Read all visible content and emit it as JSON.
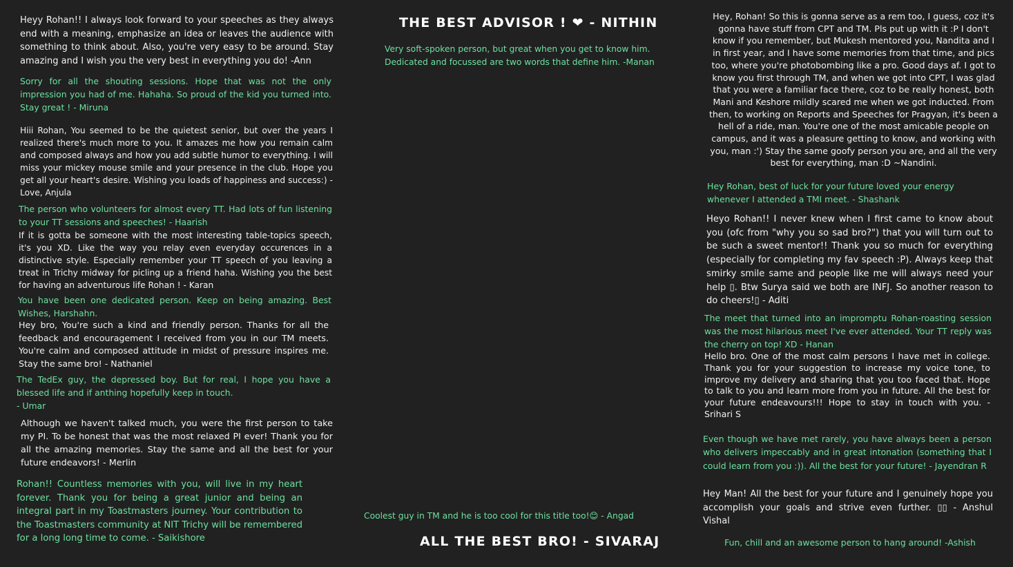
{
  "left": [
    "Heyy Rohan!! I always look forward to your speeches as they always end with a meaning, emphasize an idea or leaves the audience with something to think about. Also, you're very easy to be around. Stay amazing and I wish you the very best in everything you do!  -Ann",
    "Sorry for all the shouting sessions. Hope that was not the only impression you had of me. Hahaha. So proud of the kid you turned into. Stay great !  - Miruna",
    "Hiii Rohan, You seemed to be the quietest senior, but over the years I realized there's much more to you. It amazes me how you remain calm and composed always and how you add subtle humor to everything. I will miss your mickey mouse smile and your presence in the club. Hope you get all your heart's desire. Wishing you loads of happiness and success:) -Love, Anjula",
    "The person who volunteers for almost every TT. Had lots of fun listening to your TT sessions and speeches!  - Haarish",
    "If it is gotta be someone with the most interesting table-topics speech, it's you XD. Like the way you relay even everyday occurences in a distinctive style. Especially remember your TT speech of you leaving a treat in Trichy midway for picling up a friend haha. Wishing you the best for having an adventurous life Rohan ! - Karan",
    "You have been one dedicated person. Keep on being amazing. Best Wishes, Harshahn.",
    "Hey bro, You're such a kind and friendly person. Thanks for all the feedback and encouragement I received from you in our TM meets. You're calm and composed attitude in midst of pressure inspires me. Stay the same bro!  - Nathaniel",
    "The TedEx guy, the depressed boy. But for real, I hope you have a blessed life and if anthing hopefully keep in touch.",
    "- Umar",
    "Although we haven't talked much, you were the first person to take my PI. To be honest that was the most relaxed PI ever! Thank you for all the amazing memories. Stay the same and all the best for your future endeavors! - Merlin",
    "Rohan!! Countless memories with you, will live in my heart forever. Thank you for being a great junior and being an integral part in my Toastmasters journey. Your contribution to the Toastmasters community at NIT Trichy will be remembered for a long long time to come.  - Saikishore"
  ],
  "middle": {
    "heading_top": "THE BEST ADVISOR ! ❤ - NITHIN",
    "note_top": "Very soft-spoken person, but great when you get to know him. Dedicated and focussed are two words that define him. -Manan",
    "note_bottom": "Coolest guy in TM and he is too cool for this title too!😊 - Angad",
    "heading_bottom": "ALL THE BEST BRO! - SIVARAJ"
  },
  "right": [
    "Hey, Rohan! So this is gonna serve as a rem too, I guess, coz it's gonna have stuff from CPT and TM. Pls put up with it :P I don't know if you remember, but Mukesh mentored you, Nandita and I in first year, and I have some memories from that time, and pics too, where you're photobombing like a pro. Good days af. I got to know you first through TM, and when we got into CPT, I was glad that you were a familiar face there, coz to be really honest, both Mani and Keshore mildly scared me when we got inducted. From then, to working on Reports and Speeches for Pragyan, it's been a hell of a ride, man. You're one of the most amicable people on campus, and it was a pleasure getting to know, and working with you, man :') Stay the same goofy person you are, and all the very best for everything, man :D ~Nandini.",
    "Hey Rohan, best of luck for your future loved your energy whenever I attended a TMI meet.  - Shashank",
    "Heyo Rohan!! I never knew when I first came to know about you (ofc from \"why you so sad bro?\") that you will turn out to be such a sweet mentor!! Thank you so much for everything (especially for completing my fav speech :P). Always keep that smirky smile same and people like me will always need your help ▯. Btw Surya said we both are INFJ. So another reason to do cheers!▯ - Aditi",
    "The meet that turned into an impromptu Rohan-roasting session was the most hilarious meet I've ever attended. Your TT reply was the cherry on top! XD  - Hanan",
    "Hello bro. One of the most calm persons I have met in college. Thank you for your suggestion to increase my voice tone, to improve my delivery and sharing that you too faced that. Hope to talk to you and learn more from you in future. All the best for your future endeavours!!! Hope to stay in touch with you.  - Srihari S",
    "Even though we have met rarely, you have always been a person who delivers impeccably and in great intonation (something that I could learn from you :)). All the best for your future!  - Jayendran R",
    "Hey Man! All the best for your future and I genuinely hope you accomplish your goals and strive even further. ▯▯  - Anshul Vishal",
    "Fun, chill and an awesome person to hang around!  -Ashish"
  ]
}
